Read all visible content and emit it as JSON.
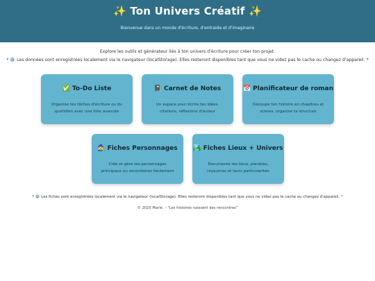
{
  "header": {
    "title": "Ton Univers Créatif",
    "spark_left": "✨",
    "spark_right": "✨",
    "subtitle": "Bienvenue dans un monde d'écriture, d'entraide et d'imaginaire"
  },
  "intro": {
    "line1": "Explore les outils et générateur liés à ton univers d'écriture pour créer ton projet.",
    "line2": "Les données sont enregistrées localement via le navigateur (localStorage). Elles resteront disponibles tant que vous ne videz pas le cache ou changez d'appareil."
  },
  "cards": [
    {
      "icon": "✅",
      "title": "To-Do Liste",
      "desc": "Organise tes tâches d'écriture ou du quotidien avec une liste avancée"
    },
    {
      "icon": "📓",
      "title": "Carnet de Notes",
      "desc": "Un espace pour écrire tes idées, citations, réflexions d'auteur"
    },
    {
      "icon": "📅",
      "title": "Planificateur de roman",
      "desc": "Découpe ton histoire en chapitres et scènes, organise ta structure"
    },
    {
      "icon": "🧙",
      "title": "Fiches Personnages",
      "desc": "Crée et gère tes personnages principaux ou secondaires facilement"
    },
    {
      "icon": "🏞️",
      "title": "Fiches Lieux + Univers",
      "desc": "Documente tes lieux, planètes, royaumes et leurs particularités"
    }
  ],
  "note": "Les fiches sont enregistrées localement via le navigateur (localStorage). Elles resteront disponibles tant que vous ne videz pas le cache ou changez d'appareil.",
  "gear_symbol": "⚙️",
  "note_marker": "*",
  "footer": "© 2025 Marie. – \"Les histoires naissent des rencontres\""
}
